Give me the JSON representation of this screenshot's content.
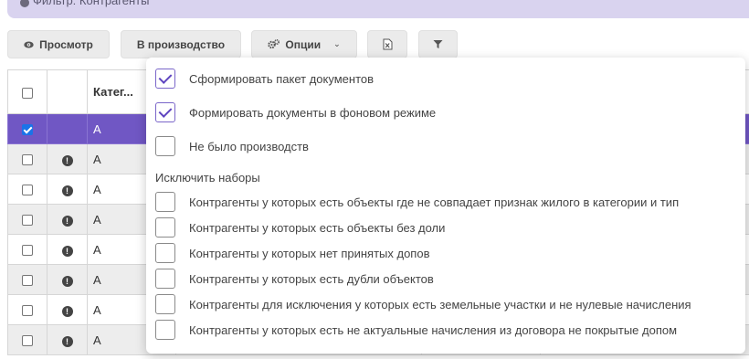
{
  "filter_bar": {
    "title": "Фильтр: Контрагенты"
  },
  "toolbar": {
    "view_label": "Просмотр",
    "production_label": "В производство",
    "options_label": "Опции"
  },
  "table": {
    "header": {
      "category": "Катег..."
    },
    "rows": [
      {
        "value": "А",
        "checked": true,
        "selected": true,
        "warning": false
      },
      {
        "value": "А",
        "checked": false,
        "selected": false,
        "warning": true
      },
      {
        "value": "А",
        "checked": false,
        "selected": false,
        "warning": true
      },
      {
        "value": "А",
        "checked": false,
        "selected": false,
        "warning": true
      },
      {
        "value": "А",
        "checked": false,
        "selected": false,
        "warning": true
      },
      {
        "value": "А",
        "checked": false,
        "selected": false,
        "warning": true
      },
      {
        "value": "А",
        "checked": false,
        "selected": false,
        "warning": true
      },
      {
        "value": "А",
        "checked": false,
        "selected": false,
        "warning": true
      }
    ]
  },
  "options_menu": {
    "top_options": [
      {
        "label": "Сформировать пакет документов",
        "checked": true
      },
      {
        "label": "Формировать документы в фоновом режиме",
        "checked": true
      },
      {
        "label": "Не было производств",
        "checked": false
      }
    ],
    "exclude_label": "Исключить наборы",
    "exclude_options": [
      {
        "label": "Контрагенты у которых есть объекты где не совпадает признак жилого в категории и тип",
        "checked": false
      },
      {
        "label": "Контрагенты у которых есть объекты без доли",
        "checked": false
      },
      {
        "label": "Контрагенты у которых нет принятых допов",
        "checked": false
      },
      {
        "label": "Контрагенты у которых есть дубли объектов",
        "checked": false
      },
      {
        "label": "Контрагенты для исключения у которых есть земельные участки и не нулевые начисления",
        "checked": false
      },
      {
        "label": "Контрагенты у которых есть не актуальные начисления из договора не покрытые допом",
        "checked": false
      }
    ]
  },
  "colors": {
    "accent": "#7057c4",
    "filter_bar": "#d9d3ef",
    "stripe": "#ededed"
  }
}
